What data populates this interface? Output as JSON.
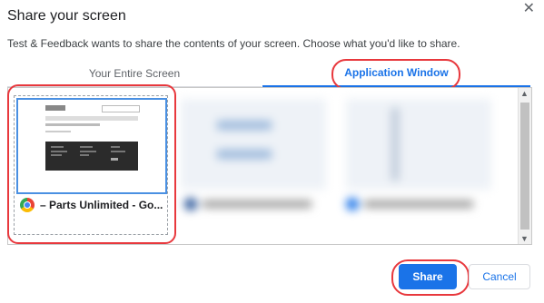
{
  "dialog": {
    "title": "Share your screen",
    "subtitle": "Test & Feedback wants to share the contents of your screen. Choose what you'd like to share.",
    "close_icon": "close-icon"
  },
  "tabs": [
    {
      "label": "Your Entire Screen",
      "active": false
    },
    {
      "label": "Application Window",
      "active": true
    }
  ],
  "sources": [
    {
      "label": "– Parts Unlimited - Go...",
      "icon": "chrome-icon",
      "selected": true
    }
  ],
  "buttons": {
    "share_label": "Share",
    "cancel_label": "Cancel"
  },
  "colors": {
    "accent": "#1a73e8",
    "highlight": "#e8383d"
  }
}
